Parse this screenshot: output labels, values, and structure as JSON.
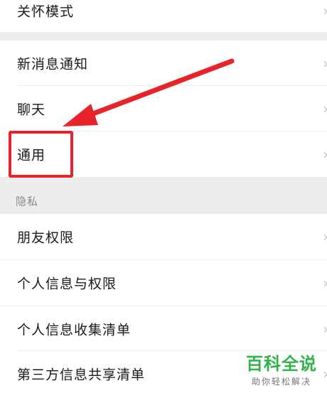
{
  "group_top": {
    "items": [
      {
        "label": "关怀模式"
      }
    ]
  },
  "group_main": {
    "items": [
      {
        "label": "新消息通知"
      },
      {
        "label": "聊天"
      },
      {
        "label": "通用"
      }
    ]
  },
  "privacy_section": {
    "header": "隐私",
    "items": [
      {
        "label": "朋友权限"
      },
      {
        "label": "个人信息与权限"
      },
      {
        "label": "个人信息收集清单"
      },
      {
        "label": "第三方信息共享清单"
      }
    ]
  },
  "chevron_icon": "chevron-right-icon",
  "annotation": {
    "highlight_color": "#e8232a",
    "arrow_color": "#e8232a"
  },
  "watermark": {
    "title": "百科全说",
    "subtitle": "助你轻松解决"
  }
}
